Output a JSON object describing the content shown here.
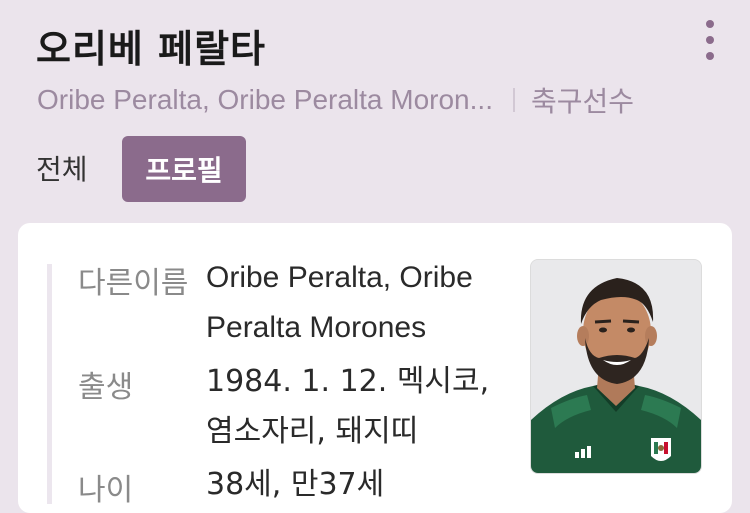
{
  "header": {
    "title": "오리베 페랄타",
    "other_names": "Oribe Peralta, Oribe Peralta Moron...",
    "category": "축구선수"
  },
  "tabs": [
    {
      "label": "전체",
      "selected": false
    },
    {
      "label": "프로필",
      "selected": true
    }
  ],
  "profile": {
    "alias_label": "다른이름",
    "alias_value": "Oribe Peralta, Oribe Peralta Morones",
    "birth_label": "출생",
    "birth_value": "1984. 1. 12. 멕시코, 염소자리, 돼지띠",
    "age_label": "나이",
    "age_value": "38세, 만37세"
  },
  "colors": {
    "accent": "#8b6b8c",
    "background": "#ebe4ec",
    "jersey": "#1f5a3c"
  },
  "icons": {
    "menu": "more-vertical-icon"
  }
}
